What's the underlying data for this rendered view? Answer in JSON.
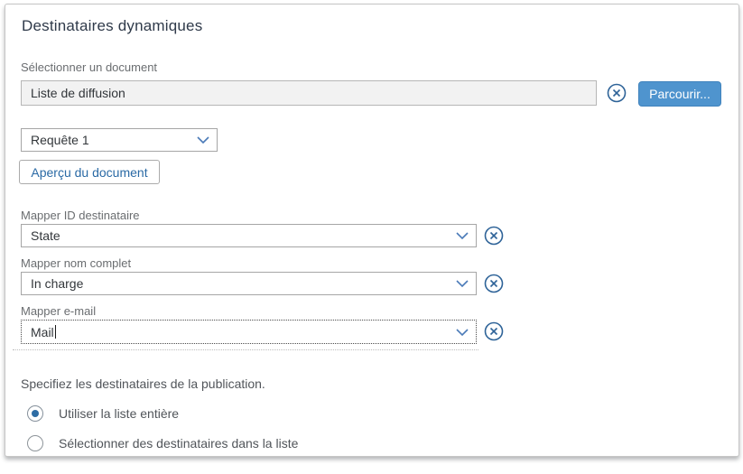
{
  "panel": {
    "title": "Destinataires dynamiques"
  },
  "document_section": {
    "label": "Sélectionner un document",
    "value": "Liste de diffusion",
    "browse_button": "Parcourir...",
    "query_value": "Requête 1",
    "preview_button": "Aperçu du document"
  },
  "mappings": [
    {
      "label": "Mapper ID destinataire",
      "value": "State"
    },
    {
      "label": "Mapper nom complet",
      "value": "In charge"
    },
    {
      "label": "Mapper e-mail",
      "value": "Mail",
      "focused": true
    }
  ],
  "recipients": {
    "prompt": "Specifiez les destinataires de la publication.",
    "options": [
      {
        "label": "Utiliser la liste entière",
        "selected": true
      },
      {
        "label": "Sélectionner des destinataires dans la liste",
        "selected": false
      }
    ]
  },
  "icons": {
    "clear": "circled-x-icon",
    "dropdown": "chevron-down-icon"
  },
  "colors": {
    "accent_blue": "#4f94ce",
    "link_blue": "#2a6aa5",
    "icon_blue": "#2e6398",
    "chevron_blue": "#4a7ab8",
    "radio_dot_blue": "#2e6da4",
    "label_gray": "#6a6d70",
    "text_dark": "#32363a",
    "readonly_bg": "#f2f2f2"
  }
}
